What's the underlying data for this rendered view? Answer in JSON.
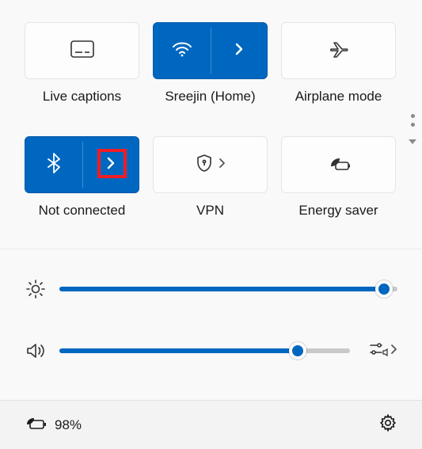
{
  "tiles": {
    "live_captions": {
      "label": "Live captions",
      "active": false
    },
    "wifi": {
      "label": "Sreejin (Home)",
      "active": true
    },
    "airplane": {
      "label": "Airplane mode",
      "active": false
    },
    "bluetooth": {
      "label": "Not connected",
      "active": true,
      "highlighted_chevron": true
    },
    "vpn": {
      "label": "VPN",
      "active": false
    },
    "energy": {
      "label": "Energy saver",
      "active": false
    }
  },
  "sliders": {
    "brightness": {
      "percent": 96
    },
    "volume": {
      "percent": 82
    }
  },
  "footer": {
    "battery_text": "98%"
  },
  "colors": {
    "accent": "#0067c0",
    "highlight": "#ee1c25"
  }
}
